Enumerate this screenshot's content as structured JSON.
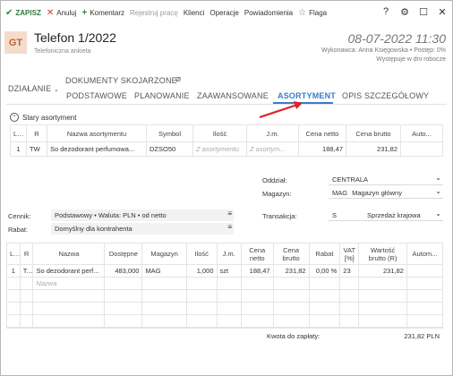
{
  "toolbar": {
    "save": "ZAPISZ",
    "cancel": "Anuluj",
    "comment": "Komentarz",
    "register_work": "Rejestruj pracę",
    "clients": "Klienci",
    "operations": "Operacje",
    "notifications": "Powiadomienia",
    "flag": "Flaga"
  },
  "window_controls": {
    "help": "?",
    "settings": "⚙",
    "maximize": "☐",
    "close": "✕"
  },
  "header": {
    "avatar": "GT",
    "title": "Telefon 1/2022",
    "subtitle": "Telefoniczna ankieta",
    "date": "08-07-2022 11:30",
    "meta": "Wykonawca: Anna Księgowska • Postęp: 0%",
    "meta2": "Występuje w dni robocze"
  },
  "tabs": {
    "action": "DZIAŁANIE",
    "documents": "DOKUMENTY SKOJARZONE",
    "basic": "PODSTAWOWE",
    "planning": "PLANOWANIE",
    "advanced": "ZAAWANSOWANE",
    "assortment": "ASORTYMENT",
    "detailed": "OPIS SZCZEGÓŁOWY"
  },
  "section": {
    "title": "Stary asortyment"
  },
  "old_table": {
    "headers": [
      "Lp",
      "R",
      "Nazwa asortymentu",
      "Symbol",
      "Ilość",
      "J.m.",
      "Cena netto",
      "Cena brutto",
      "Auto..."
    ],
    "row": [
      "1",
      "TW",
      "So dezodorant perfumowa...",
      "DZSO50",
      "Z asortymentu",
      "Z asortym...",
      "188,47",
      "231,82",
      ""
    ]
  },
  "form": {
    "department_label": "Oddział:",
    "department_value": "CENTRALA",
    "warehouse_label": "Magazyn:",
    "warehouse_code": "MAG",
    "warehouse_value": "Magazyn główny",
    "pricelist_label": "Cennik:",
    "pricelist_value": "Podstawowy • Waluta: PLN • od netto",
    "discount_label": "Rabat:",
    "discount_value": "Domyślny dla kontrahenta",
    "transaction_label": "Transakcja:",
    "transaction_code": "S",
    "transaction_value": "Sprzedaż krajowa"
  },
  "items_table": {
    "headers": [
      "LP",
      "R",
      "Nazwa",
      "Dostępne",
      "Magazyn",
      "Ilość",
      "J.m.",
      "Cena netto",
      "Cena brutto",
      "Rabat",
      "VAT [%]",
      "Wartość brutto (R)",
      "Autom..."
    ],
    "row": [
      "1",
      "T...",
      "So dezodorant perf...",
      "483,000",
      "MAG",
      "1,000",
      "szt",
      "188,47",
      "231,82",
      "0,00 %",
      "23",
      "231,82",
      ""
    ],
    "name_placeholder": "Nazwa"
  },
  "total": {
    "label": "Kwota do zapłaty:",
    "value": "231,82 PLN"
  },
  "colors": {
    "accent": "#3a7dc2",
    "save_green": "#2c7a3c",
    "cancel_red": "#d2322d",
    "arrow_red": "#e0202a"
  }
}
